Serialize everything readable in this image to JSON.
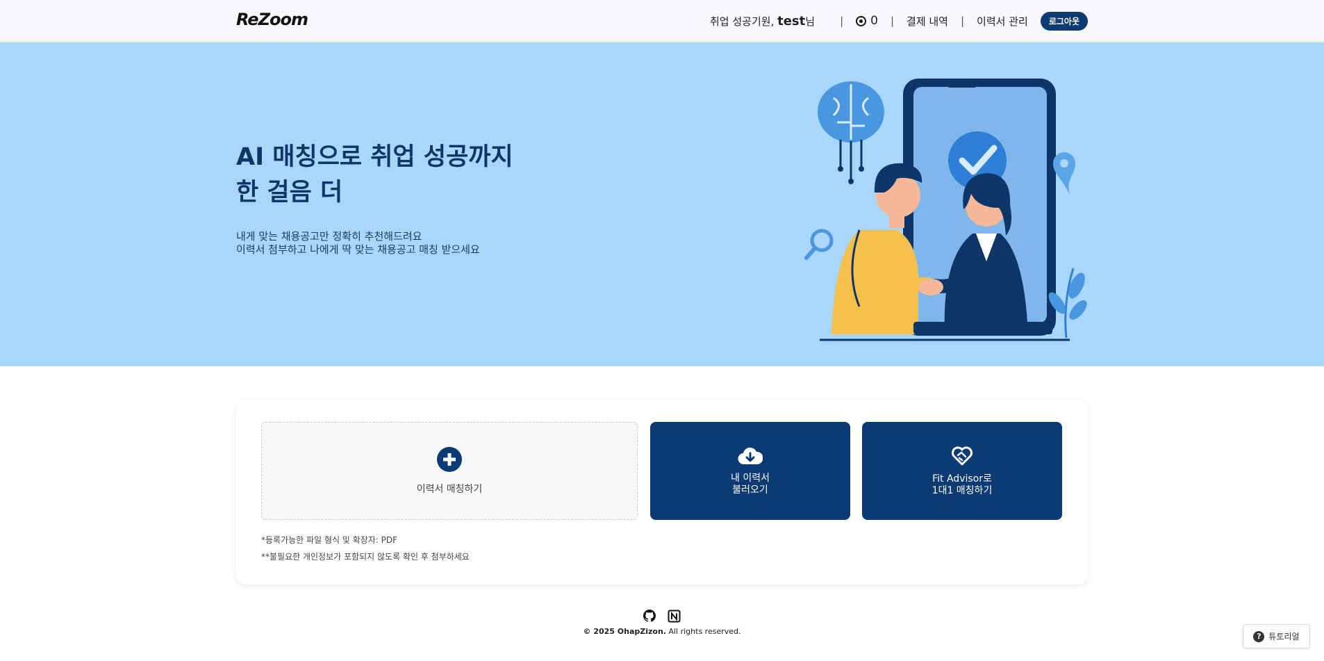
{
  "header": {
    "logo": "ReZoom",
    "greeting_prefix": "취업 성공기원, ",
    "username": "test",
    "greeting_suffix": "님",
    "credits": "0",
    "payment_history": "결제 내역",
    "resume_manage": "이력서 관리",
    "logout": "로그아웃"
  },
  "hero": {
    "title_line1": "AI 매칭으로 취업 성공까지",
    "title_line2": "한 걸음 더",
    "sub_line1": "내게 맞는 채용공고만 정확히 추천해드려요",
    "sub_line2": "이력서 첨부하고 나에게 딱 맞는 채용공고 매칭 받으세요"
  },
  "actions": {
    "upload_label": "이력서 매칭하기",
    "load_label": "내 이력서\n불러오기",
    "fit_label": "Fit Advisor로\n1대1 매칭하기"
  },
  "notes": {
    "note1": "*등록가능한 파일 형식 및 확장자: PDF",
    "note2": "**불필요한 개인정보가 포함되지 않도록 확인 후 첨부하세요"
  },
  "footer": {
    "copyright_bold": "© 2025 OhapZizon.",
    "copyright_rest": " All rights reserved."
  },
  "tutorial": {
    "label": "튜토리얼"
  },
  "colors": {
    "brand_navy": "#0c3a72",
    "hero_bg": "#a9d6fb"
  },
  "icons": [
    "credit-icon",
    "plus-icon",
    "cloud-download-icon",
    "heart-handshake-icon",
    "github-icon",
    "notion-icon",
    "help-icon"
  ]
}
